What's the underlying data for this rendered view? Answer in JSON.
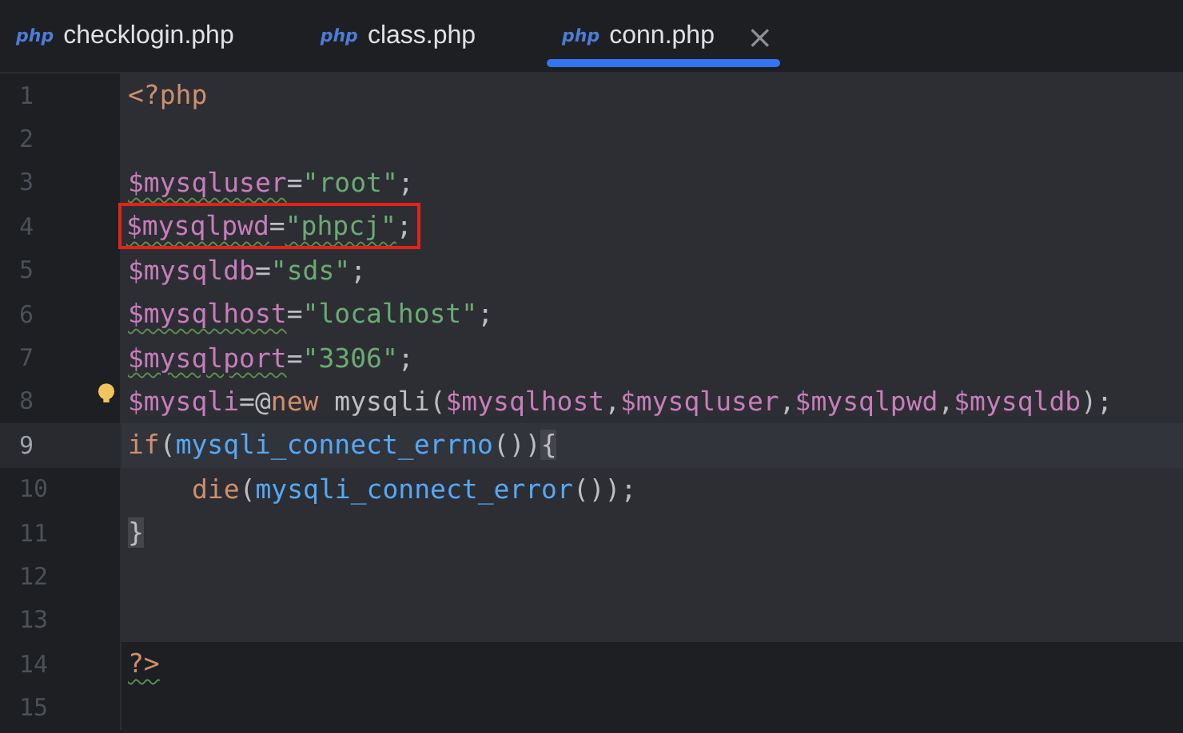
{
  "tabs": [
    {
      "icon": "php",
      "label": "checklogin.php",
      "selected": false
    },
    {
      "icon": "php",
      "label": "class.php",
      "selected": false
    },
    {
      "icon": "php",
      "label": "conn.php",
      "selected": true,
      "close": "×"
    }
  ],
  "blocks": [
    {
      "highlighted": true,
      "lines": [
        {
          "number": "1",
          "current": false,
          "boxed": false,
          "bulb": false,
          "tokens": [
            {
              "kind": "tag",
              "text": "<?php"
            }
          ]
        },
        {
          "number": "2",
          "current": false,
          "boxed": false,
          "bulb": false
        },
        {
          "number": "3",
          "current": false,
          "boxed": false,
          "bulb": false,
          "tokens": [
            {
              "kind": "var",
              "text": "$mysqluser",
              "warn": true
            },
            {
              "kind": "op",
              "text": "="
            },
            {
              "kind": "str",
              "text": "\"root\""
            },
            {
              "kind": "op",
              "text": ";"
            }
          ]
        },
        {
          "number": "4",
          "current": false,
          "boxed": true,
          "bulb": false,
          "tokens": [
            {
              "kind": "var",
              "text": "$mysqlpwd",
              "warn": true
            },
            {
              "kind": "op",
              "text": "="
            },
            {
              "kind": "str",
              "text": "\"phpcj\"",
              "warn": true
            },
            {
              "kind": "op",
              "text": ";"
            }
          ]
        },
        {
          "number": "5",
          "current": false,
          "boxed": false,
          "bulb": false,
          "tokens": [
            {
              "kind": "var",
              "text": "$mysqldb"
            },
            {
              "kind": "op",
              "text": "="
            },
            {
              "kind": "str",
              "text": "\"sds\""
            },
            {
              "kind": "op",
              "text": ";"
            }
          ]
        },
        {
          "number": "6",
          "current": false,
          "boxed": false,
          "bulb": false,
          "tokens": [
            {
              "kind": "var",
              "text": "$mysqlhost",
              "warn": true
            },
            {
              "kind": "op",
              "text": "="
            },
            {
              "kind": "str",
              "text": "\"localhost\""
            },
            {
              "kind": "op",
              "text": ";"
            }
          ]
        },
        {
          "number": "7",
          "current": false,
          "boxed": false,
          "bulb": false,
          "tokens": [
            {
              "kind": "var",
              "text": "$mysqlport",
              "warn": true
            },
            {
              "kind": "op",
              "text": "="
            },
            {
              "kind": "str",
              "text": "\"3306\""
            },
            {
              "kind": "op",
              "text": ";"
            }
          ]
        },
        {
          "number": "8",
          "current": false,
          "boxed": false,
          "bulb": true,
          "tokens": [
            {
              "kind": "var",
              "text": "$mysqli"
            },
            {
              "kind": "op",
              "text": "=@"
            },
            {
              "kind": "kw",
              "text": "new"
            },
            {
              "kind": "op",
              "text": " mysqli("
            },
            {
              "kind": "var",
              "text": "$mysqlhost"
            },
            {
              "kind": "op",
              "text": ","
            },
            {
              "kind": "var",
              "text": "$mysqluser"
            },
            {
              "kind": "op",
              "text": ","
            },
            {
              "kind": "var",
              "text": "$mysqlpwd"
            },
            {
              "kind": "op",
              "text": ","
            },
            {
              "kind": "var",
              "text": "$mysqldb"
            },
            {
              "kind": "op",
              "text": ");"
            }
          ]
        },
        {
          "number": "9",
          "current": true,
          "boxed": false,
          "bulb": false,
          "tokens": [
            {
              "kind": "kw",
              "text": "if"
            },
            {
              "kind": "op",
              "text": "("
            },
            {
              "kind": "fn",
              "text": "mysqli_connect_errno"
            },
            {
              "kind": "op",
              "text": "())"
            },
            {
              "kind": "op",
              "text": "{",
              "matched": true
            }
          ]
        },
        {
          "number": "10",
          "current": false,
          "boxed": false,
          "bulb": false,
          "indent": true,
          "tokens": [
            {
              "kind": "kw",
              "text": "die"
            },
            {
              "kind": "op",
              "text": "("
            },
            {
              "kind": "fn",
              "text": "mysqli_connect_error"
            },
            {
              "kind": "op",
              "text": "());"
            }
          ]
        },
        {
          "number": "11",
          "current": false,
          "boxed": false,
          "bulb": false,
          "tokens": [
            {
              "kind": "op",
              "text": "}",
              "matched": true
            }
          ]
        },
        {
          "number": "12",
          "current": false,
          "boxed": false,
          "bulb": false
        },
        {
          "number": "13",
          "current": false,
          "boxed": false,
          "bulb": false
        }
      ]
    },
    {
      "highlighted": false,
      "lines": [
        {
          "number": "14",
          "current": false,
          "boxed": false,
          "bulb": false,
          "tokens": [
            {
              "kind": "tag",
              "text": "?>",
              "warn": true
            }
          ]
        },
        {
          "number": "15",
          "current": false,
          "boxed": false,
          "bulb": false
        }
      ]
    }
  ]
}
